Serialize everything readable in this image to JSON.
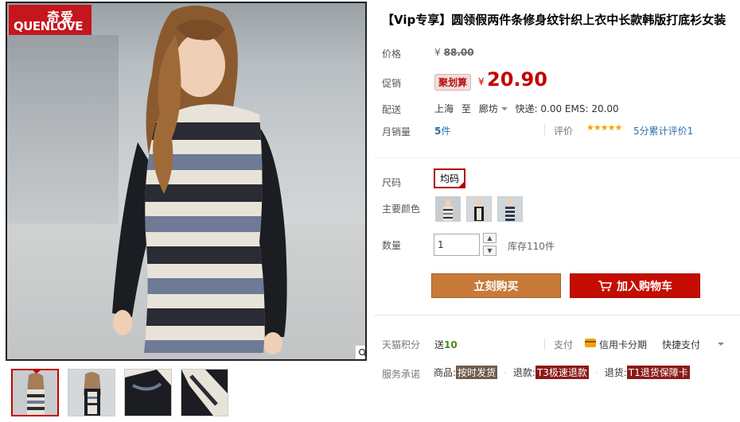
{
  "product": {
    "title": "【Vip专享】圆领假两件条修身纹针织上衣中长款韩版打底衫女装"
  },
  "brand": {
    "logo_cn": "奇爱",
    "logo_en": "QUENLOVE"
  },
  "price": {
    "label": "价格",
    "currency": "¥",
    "original": "88.00"
  },
  "promo": {
    "label": "促销",
    "badge": "聚划算",
    "currency": "¥",
    "price": "20.90"
  },
  "shipping": {
    "label": "配送",
    "from": "上海",
    "to_word": "至",
    "to": "廊坊",
    "fee": "快递: 0.00 EMS: 20.00"
  },
  "sales": {
    "label": "月销量",
    "count": "5",
    "unit": "件"
  },
  "reviews": {
    "label": "评价",
    "stars": "★★★★★",
    "text": "5分累计评价1"
  },
  "options": {
    "size_label": "尺码",
    "size_value": "均码",
    "color_label": "主要颜色",
    "color_count": 3
  },
  "quantity": {
    "label": "数量",
    "value": "1",
    "up": "▲",
    "down": "▼",
    "stock": "库存110件"
  },
  "actions": {
    "buy_now": "立刻购买",
    "add_cart": "加入购物车"
  },
  "points": {
    "label": "天猫积分",
    "prefix": "送",
    "value": "10"
  },
  "payment": {
    "label": "支付",
    "installment": "信用卡分期",
    "quick": "快捷支付"
  },
  "service": {
    "label": "服务承诺",
    "item1_prefix": "商品:",
    "item1_tag": "按时发货",
    "item2_prefix": "退款:",
    "item2_tag": "T3极速退款",
    "item3_prefix": "退货:",
    "item3_tag": "T1退货保障卡",
    "dot": "·"
  },
  "colors": {
    "accent_red": "#c40000",
    "buy_orange": "#c77a3a",
    "cart_red": "#c40d00"
  }
}
